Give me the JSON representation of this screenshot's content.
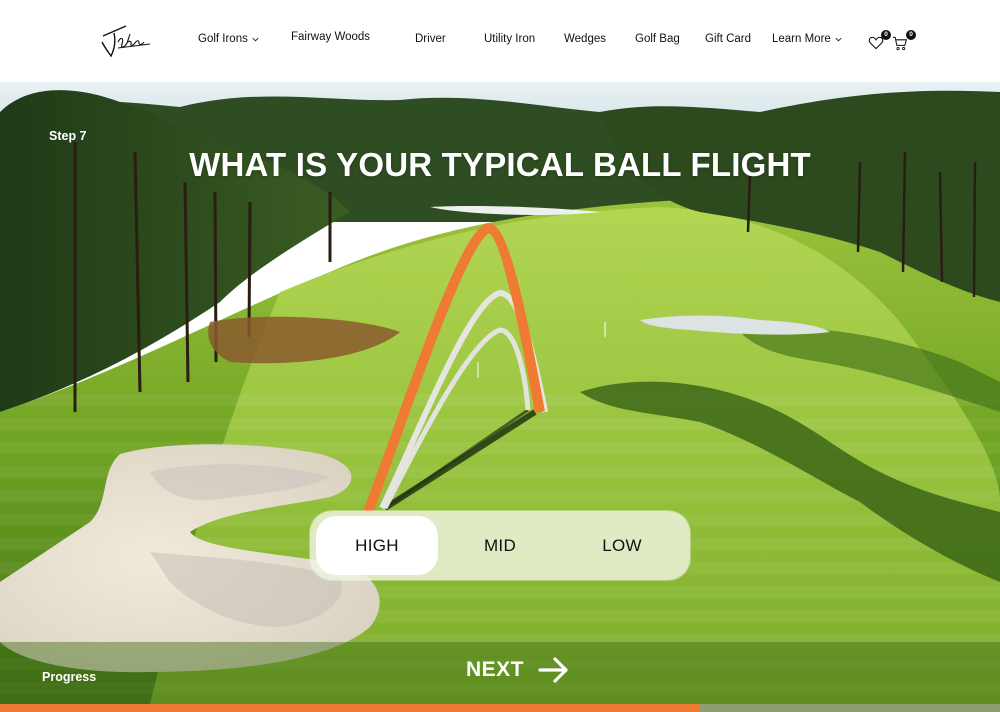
{
  "brand": {
    "logo_text": "Takomo"
  },
  "nav": {
    "items": [
      {
        "label": "Golf Irons",
        "has_dropdown": true
      },
      {
        "label": "Fairway Woods",
        "has_dropdown": false
      },
      {
        "label": "Driver",
        "has_dropdown": false
      },
      {
        "label": "Utility Iron",
        "has_dropdown": false
      },
      {
        "label": "Wedges",
        "has_dropdown": false
      },
      {
        "label": "Golf Bag",
        "has_dropdown": false
      },
      {
        "label": "Gift Card",
        "has_dropdown": false
      },
      {
        "label": "Learn More",
        "has_dropdown": true
      }
    ],
    "wishlist": {
      "icon": "heart-icon",
      "count": "0"
    },
    "cart": {
      "icon": "cart-icon",
      "count": "0"
    }
  },
  "quiz": {
    "step_label": "Step 7",
    "question": "WHAT IS YOUR TYPICAL BALL FLIGHT",
    "options": [
      {
        "label": "HIGH",
        "selected": true
      },
      {
        "label": "MID",
        "selected": false
      },
      {
        "label": "LOW",
        "selected": false
      }
    ],
    "next_label": "NEXT",
    "next_icon": "arrow-right-icon",
    "progress_label": "Progress",
    "progress_percent": 70
  },
  "colors": {
    "accent": "#ef7a33",
    "flight_alt": "#e3e3de",
    "text_dark": "#111111"
  }
}
